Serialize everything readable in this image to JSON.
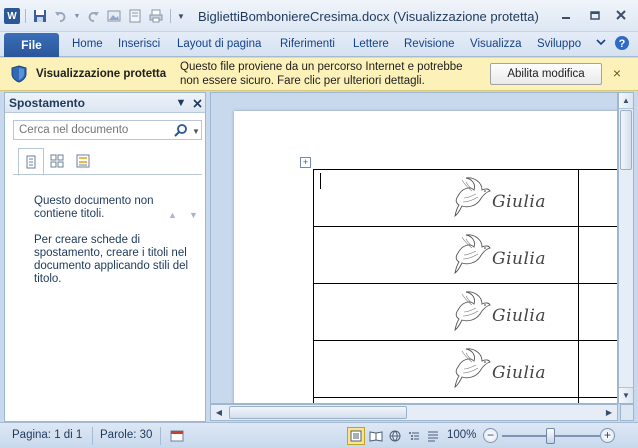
{
  "window": {
    "title": "BigliettiBomboniereCresima.docx (Visualizzazione protetta)",
    "app_icon": "W"
  },
  "ribbon": {
    "file_label": "File",
    "tabs": [
      "Home",
      "Inserisci",
      "Layout di pagina",
      "Riferimenti",
      "Lettere",
      "Revisione",
      "Visualizza",
      "Sviluppo"
    ]
  },
  "protected_bar": {
    "title": "Visualizzazione protetta",
    "message": "Questo file proviene da un percorso Internet e potrebbe non essere sicuro. Fare clic per ulteriori dettagli.",
    "enable_label": "Abilita modifica",
    "close_glyph": "×",
    "bg_color": "#fcf1b8"
  },
  "nav_pane": {
    "title": "Spostamento",
    "search_placeholder": "Cerca nel documento",
    "message_1": "Questo documento non contiene titoli.",
    "message_2": "Per creare schede di spostamento, creare i titoli nel documento applicando stili del titolo."
  },
  "document": {
    "card_name": "Giulia",
    "rows_visible": 5
  },
  "status": {
    "page": "Pagina: 1 di 1",
    "words": "Parole: 30",
    "zoom": "100%"
  }
}
